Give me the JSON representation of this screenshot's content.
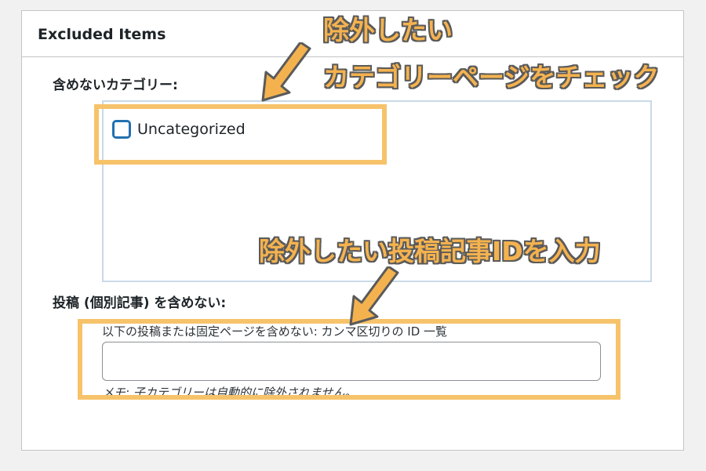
{
  "panel": {
    "title": "Excluded Items",
    "categories_label": "含めないカテゴリー:",
    "categories": [
      {
        "label": "Uncategorized",
        "checked": false
      }
    ],
    "posts_label": "投稿 (個別記事) を含めない:",
    "posts_description": "以下の投稿または固定ページを含めない: カンマ区切りの ID 一覧",
    "posts_input_value": "",
    "note": "メモ: 子カテゴリーは自動的に除外されません。"
  },
  "annotations": {
    "callout_1": "除外したい",
    "callout_2": "カテゴリーページをチェック",
    "callout_3": "除外したい投稿記事IDを入力"
  },
  "colors": {
    "highlight": "#f6c36a",
    "callout_text": "#f4b24f",
    "callout_outline": "#5a5a5a",
    "checkbox_border": "#2271b1"
  }
}
